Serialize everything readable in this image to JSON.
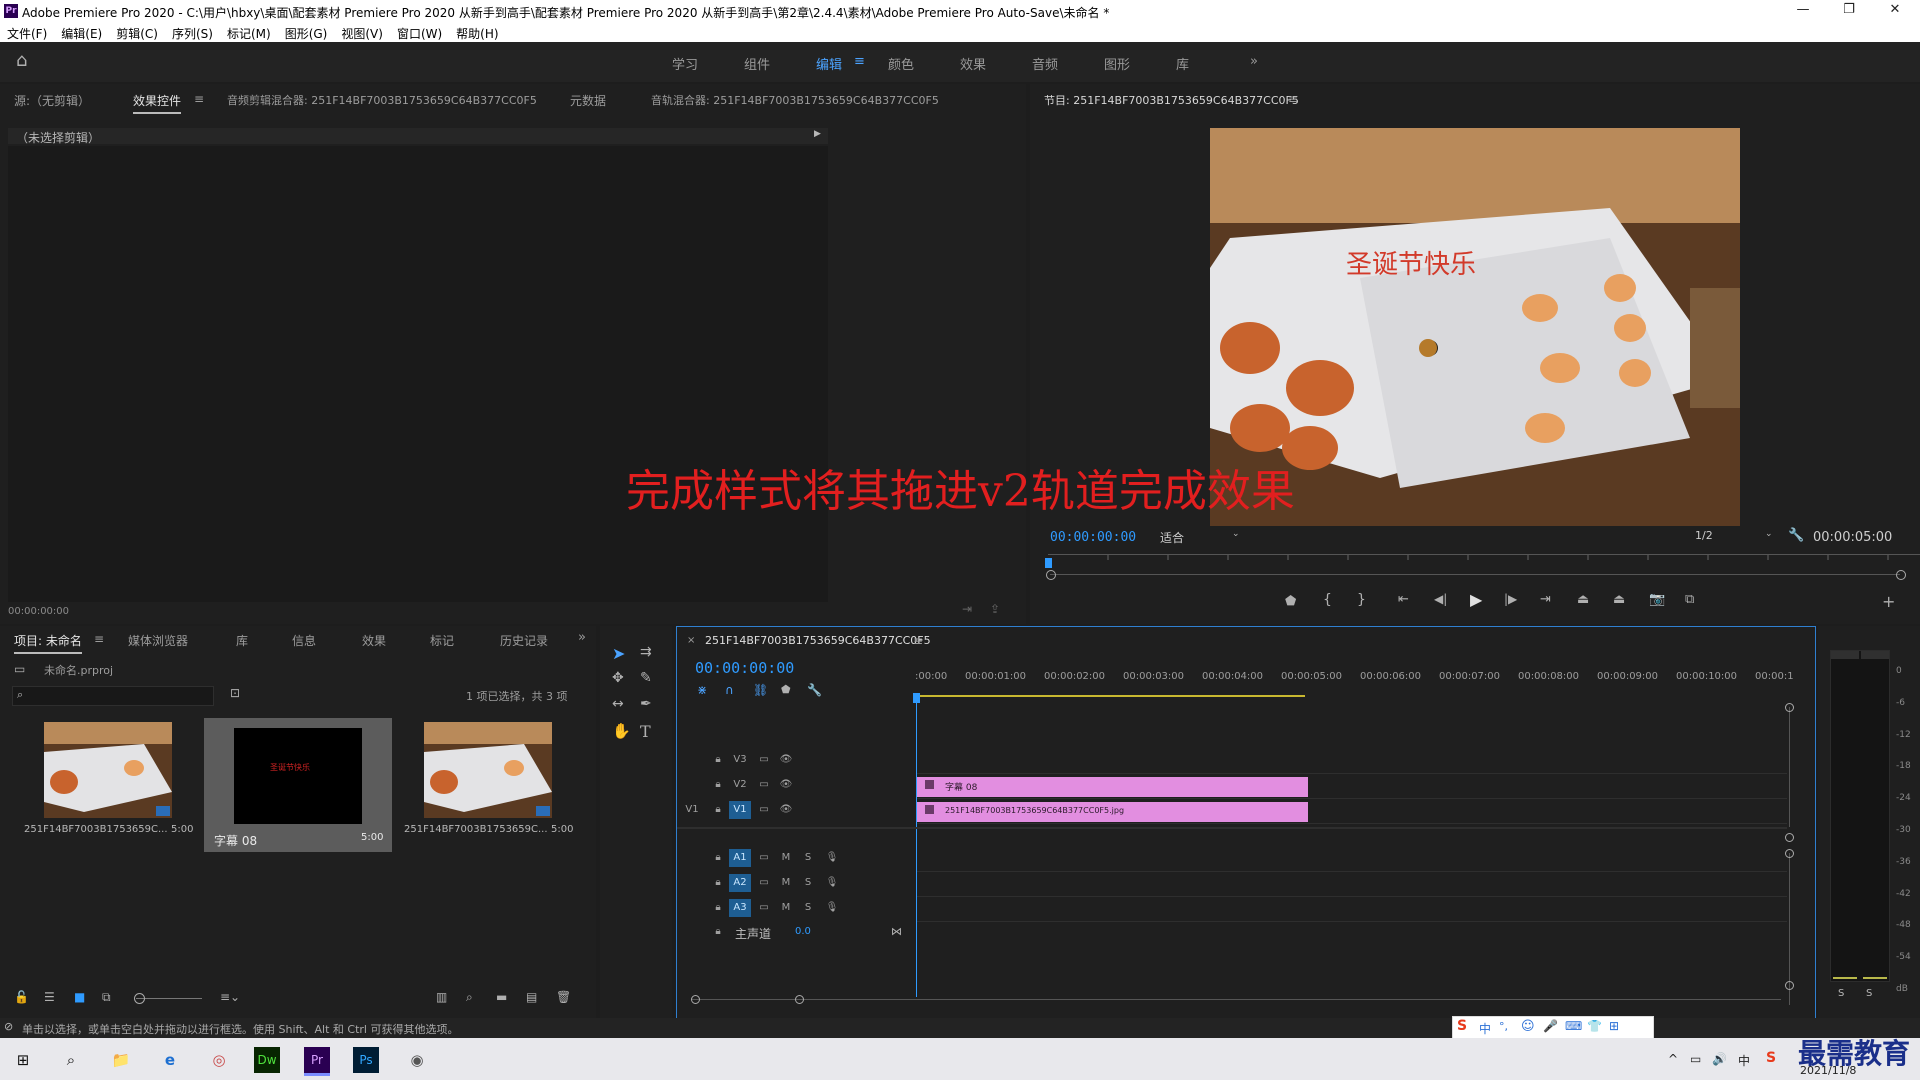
{
  "title_bar": {
    "title": "Adobe Premiere Pro 2020 - C:\\用户\\hbxy\\桌面\\配套素材 Premiere Pro 2020 从新手到高手\\配套素材 Premiere Pro 2020 从新手到高手\\第2章\\2.4.4\\素材\\Adobe Premiere Pro Auto-Save\\未命名 *",
    "app_icon": "Pr",
    "minimize": "—",
    "maximize": "❐",
    "close": "✕"
  },
  "menu": [
    "文件(F)",
    "编辑(E)",
    "剪辑(C)",
    "序列(S)",
    "标记(M)",
    "图形(G)",
    "视图(V)",
    "窗口(W)",
    "帮助(H)"
  ],
  "workspaces": {
    "items": [
      "学习",
      "组件",
      "编辑",
      "颜色",
      "效果",
      "音频",
      "图形",
      "库"
    ],
    "active": "编辑",
    "more": "»"
  },
  "source_panel": {
    "tabs": [
      "源:（无剪辑）",
      "效果控件",
      "音频剪辑混合器: 251F14BF7003B1753659C64B377CC0F5",
      "元数据",
      "音轨混合器: 251F14BF7003B1753659C64B377CC0F5"
    ],
    "active_tab": "效果控件",
    "no_clip_label": "（未选择剪辑）",
    "timecode": "00:00:00:00"
  },
  "program_monitor": {
    "tab_label": "节目: 251F14BF7003B1753659C64B377CC0F5",
    "overlay_title": "圣诞节快乐",
    "timecode": "00:00:00:00",
    "fit_label": "适合",
    "resolution": "1/2",
    "duration": "00:00:05:00"
  },
  "overlay_caption": "完成样式将其拖进v2轨道完成效果",
  "project_panel": {
    "tabs": [
      "项目: 未命名",
      "媒体浏览器",
      "库",
      "信息",
      "效果",
      "标记",
      "历史记录"
    ],
    "active_tab": "项目: 未命名",
    "project_file": "未命名.prproj",
    "selection_info": "1 项已选择，共 3 项",
    "search_placeholder": "",
    "items": [
      {
        "name": "251F14BF7003B1753659C...",
        "duration": "5:00",
        "kind": "image"
      },
      {
        "name": "字幕 08",
        "duration": "5:00",
        "kind": "title",
        "thumb_text": "圣诞节快乐"
      },
      {
        "name": "251F14BF7003B1753659C...",
        "duration": "5:00",
        "kind": "image"
      }
    ]
  },
  "timeline": {
    "tab_label": "251F14BF7003B1753659C64B377CC0F5",
    "timecode": "00:00:00:00",
    "ruler": [
      ":00:00",
      "00:00:01:00",
      "00:00:02:00",
      "00:00:03:00",
      "00:00:04:00",
      "00:00:05:00",
      "00:00:06:00",
      "00:00:07:00",
      "00:00:08:00",
      "00:00:09:00",
      "00:00:10:00",
      "00:00:1"
    ],
    "video_tracks": [
      {
        "src": "",
        "label": "V3",
        "clip": ""
      },
      {
        "src": "",
        "label": "V2",
        "clip": "字幕 08"
      },
      {
        "src": "V1",
        "label": "V1",
        "clip": "251F14BF7003B1753659C64B377CC0F5.jpg"
      }
    ],
    "audio_tracks": [
      {
        "label": "A1",
        "m": "M",
        "s": "S"
      },
      {
        "label": "A2",
        "m": "M",
        "s": "S"
      },
      {
        "label": "A3",
        "m": "M",
        "s": "S"
      }
    ],
    "master": {
      "label": "主声道",
      "value": "0.0"
    }
  },
  "audio_meter": {
    "scale": [
      "0",
      "-6",
      "-12",
      "-18",
      "-24",
      "-30",
      "-36",
      "-42",
      "-48",
      "-54",
      "dB"
    ],
    "solo_left": "S",
    "solo_right": "S"
  },
  "status_bar": {
    "text": "单击以选择，或单击空白处并拖动以进行框选。使用 Shift、Alt 和 Ctrl 可获得其他选项。"
  },
  "ime_bar": [
    "S",
    "中",
    "°,",
    "☺",
    "🎤",
    "⌨",
    "👕",
    "⊞"
  ],
  "taskbar": {
    "apps": [
      "⊞",
      "⌕",
      "📁",
      "e",
      "◎",
      "Dw",
      "Pr",
      "Ps",
      "◉"
    ],
    "watermark": "最需教育",
    "date": "2021/11/8",
    "tray": [
      "^",
      "▭",
      "🔊",
      "中",
      "S"
    ]
  }
}
